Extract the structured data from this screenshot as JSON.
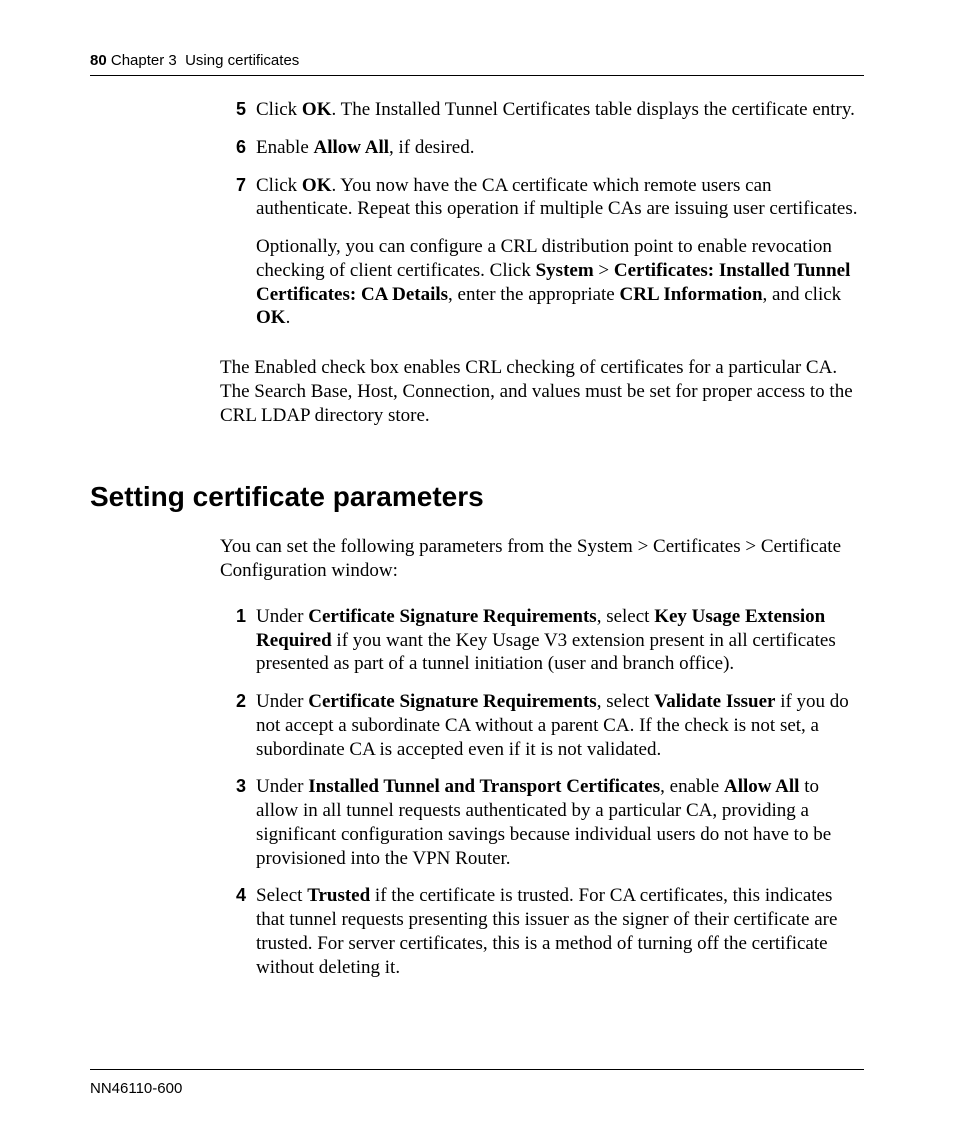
{
  "header": {
    "page_number": "80",
    "chapter_label": "Chapter 3",
    "chapter_title": "Using certificates"
  },
  "top_steps": [
    {
      "n": "5",
      "html": "Click <b>OK</b>. The Installed Tunnel Certificates table displays the certificate entry."
    },
    {
      "n": "6",
      "html": "Enable <b>Allow All</b>, if desired."
    },
    {
      "n": "7",
      "html": "Click <b>OK</b>. You now have the CA certificate which remote users can authenticate. Repeat this operation if multiple CAs are issuing user certificates.",
      "extra_html": "Optionally, you can configure a CRL distribution point to enable revocation checking of client certificates. Click <b>System</b> > <b>Certificates: Installed Tunnel Certificates: CA Details</b>, enter the appropriate <b>CRL Information</b>, and click <b>OK</b>."
    }
  ],
  "after_steps_paragraph": "The Enabled check box enables CRL checking of certificates for a particular CA. The Search Base, Host, Connection, and values must be set for proper access to the CRL LDAP directory store.",
  "section_heading": "Setting certificate parameters",
  "section_intro": "You can set the following parameters from the System > Certificates > Certificate Configuration window:",
  "section_steps": [
    {
      "n": "1",
      "html": "Under <b>Certificate Signature Requirements</b>, select <b>Key Usage Extension Required</b> if you want the Key Usage V3 extension present in all certificates presented as part of a tunnel initiation (user and branch office)."
    },
    {
      "n": "2",
      "html": "Under <b>Certificate Signature Requirements</b>, select <b>Validate Issuer</b> if you do not accept a subordinate CA without a parent CA. If the check is not set, a subordinate CA is accepted even if it is not validated."
    },
    {
      "n": "3",
      "html": "Under <b>Installed Tunnel and Transport Certificates</b>, enable <b>Allow All</b> to allow in all tunnel requests authenticated by a particular CA, providing a significant configuration savings because individual users do not have to be provisioned into the VPN Router."
    },
    {
      "n": "4",
      "html": "Select <b>Trusted</b> if the certificate is trusted. For CA certificates, this indicates that tunnel requests presenting this issuer as the signer of their certificate are trusted. For server certificates, this is a method of turning off the certificate without deleting it."
    }
  ],
  "footer": {
    "doc_id": "NN46110-600"
  }
}
